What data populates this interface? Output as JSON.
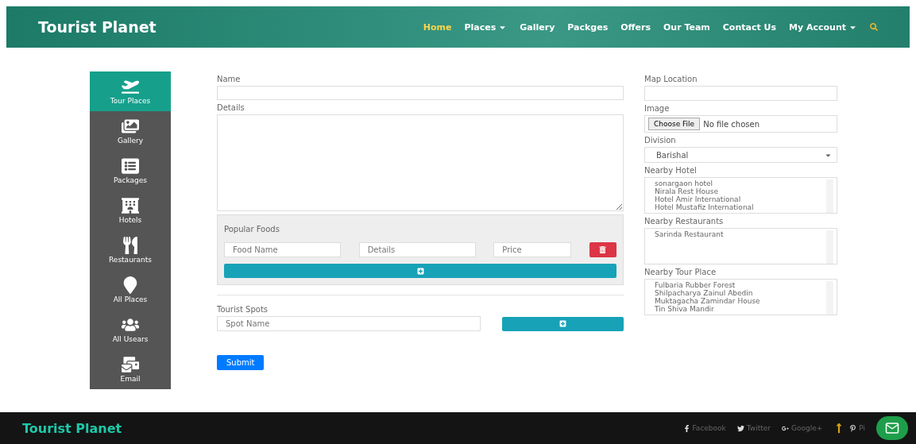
{
  "header": {
    "brand": "Tourist Planet",
    "nav": [
      {
        "label": "Home",
        "selected": true,
        "dropdown": false
      },
      {
        "label": "Places",
        "selected": false,
        "dropdown": true
      },
      {
        "label": "Gallery",
        "selected": false,
        "dropdown": false
      },
      {
        "label": "Packges",
        "selected": false,
        "dropdown": false
      },
      {
        "label": "Offers",
        "selected": false,
        "dropdown": false
      },
      {
        "label": "Our Team",
        "selected": false,
        "dropdown": false
      },
      {
        "label": "Contact Us",
        "selected": false,
        "dropdown": false
      },
      {
        "label": "My Account",
        "selected": false,
        "dropdown": true
      }
    ]
  },
  "sidebar": {
    "items": [
      {
        "kind": "plane",
        "label": "Tour Places",
        "selected": true
      },
      {
        "kind": "images",
        "label": "Gallery",
        "selected": false
      },
      {
        "kind": "list",
        "label": "Packages",
        "selected": false
      },
      {
        "kind": "hotel",
        "label": "Hotels",
        "selected": false
      },
      {
        "kind": "utensils",
        "label": "Restaurants",
        "selected": false
      },
      {
        "kind": "marker",
        "label": "All Places",
        "selected": false
      },
      {
        "kind": "users",
        "label": "All Usears",
        "selected": false
      },
      {
        "kind": "mail",
        "label": "Email",
        "selected": false
      }
    ]
  },
  "form": {
    "name_label": "Name",
    "details_label": "Details",
    "popular_foods": {
      "title": "Popular Foods",
      "placeholders": [
        "Food Name",
        "Details",
        "Price"
      ]
    },
    "tourist_spots": {
      "title": "Tourist Spots",
      "placeholder": "Spot Name"
    },
    "submit": "Submit"
  },
  "side_form": {
    "map_label": "Map Location",
    "image_label": "Image",
    "file_button": "Choose File",
    "file_status": "No file chosen",
    "division_label": "Division",
    "division_value": "Barishal",
    "lists": [
      {
        "label": "Nearby Hotel",
        "options": [
          "sonargaon hotel",
          "Nirala Rest House",
          "Hotel Amir International",
          "Hotel Mustafiz International"
        ]
      },
      {
        "label": "Nearby Restaurants",
        "options": [
          "Sarinda Restaurant"
        ]
      },
      {
        "label": "Nearby Tour Place",
        "options": [
          "Fulbaria Rubber Forest",
          "Shilpacharya Zainul Abedin",
          "Muktagacha Zamindar House",
          "Tin Shiva Mandir"
        ]
      }
    ]
  },
  "footer": {
    "brand": "Tourist Planet",
    "links": [
      {
        "kind": "facebook",
        "label": "Facebook"
      },
      {
        "kind": "twitter",
        "label": "Twitter"
      },
      {
        "kind": "google",
        "label": "Google+"
      },
      {
        "kind": "pinterest",
        "label": "Pi"
      }
    ]
  }
}
